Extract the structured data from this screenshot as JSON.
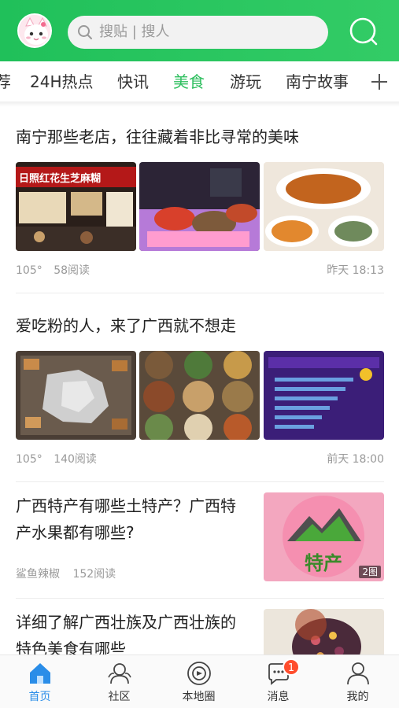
{
  "header": {
    "search_placeholder": "搜贴 | 搜人",
    "avatar": "cartoon-cat-avatar",
    "search_icon": "search-icon"
  },
  "tabs": [
    {
      "label": "荐",
      "active": false
    },
    {
      "label": "24H热点",
      "active": false
    },
    {
      "label": "快讯",
      "active": false
    },
    {
      "label": "美食",
      "active": true
    },
    {
      "label": "游玩",
      "active": false
    },
    {
      "label": "南宁故事",
      "active": false
    }
  ],
  "feed": {
    "posts": [
      {
        "title": "南宁那些老店，往往藏着非比寻常的美味",
        "thumb_banner_text": "日照红花生芝麻糊",
        "score": "105°",
        "reads": "58阅读",
        "time": "昨天 18:13"
      },
      {
        "title": "爱吃粉的人，来了广西就不想走",
        "score": "105°",
        "reads": "140阅读",
        "time": "前天 18:00"
      },
      {
        "title": "广西特产有哪些土特产？广西特产水果都有哪些?",
        "thumb_text": "特产",
        "image_count": "2图",
        "author": "鲨鱼辣椒",
        "reads": "152阅读"
      },
      {
        "title": "详细了解广西壮族及广西壮族的特色美食有哪些"
      }
    ]
  },
  "bottom_nav": [
    {
      "label": "首页",
      "icon": "home-icon",
      "active": true
    },
    {
      "label": "社区",
      "icon": "community-icon",
      "active": false
    },
    {
      "label": "本地圈",
      "icon": "local-circle-icon",
      "active": false
    },
    {
      "label": "消息",
      "icon": "message-icon",
      "active": false,
      "badge": "1"
    },
    {
      "label": "我的",
      "icon": "profile-icon",
      "active": false
    }
  ],
  "colors": {
    "brand_green": "#2fbf5f",
    "nav_active_blue": "#2a8de8",
    "badge_red": "#ff4d2d"
  }
}
